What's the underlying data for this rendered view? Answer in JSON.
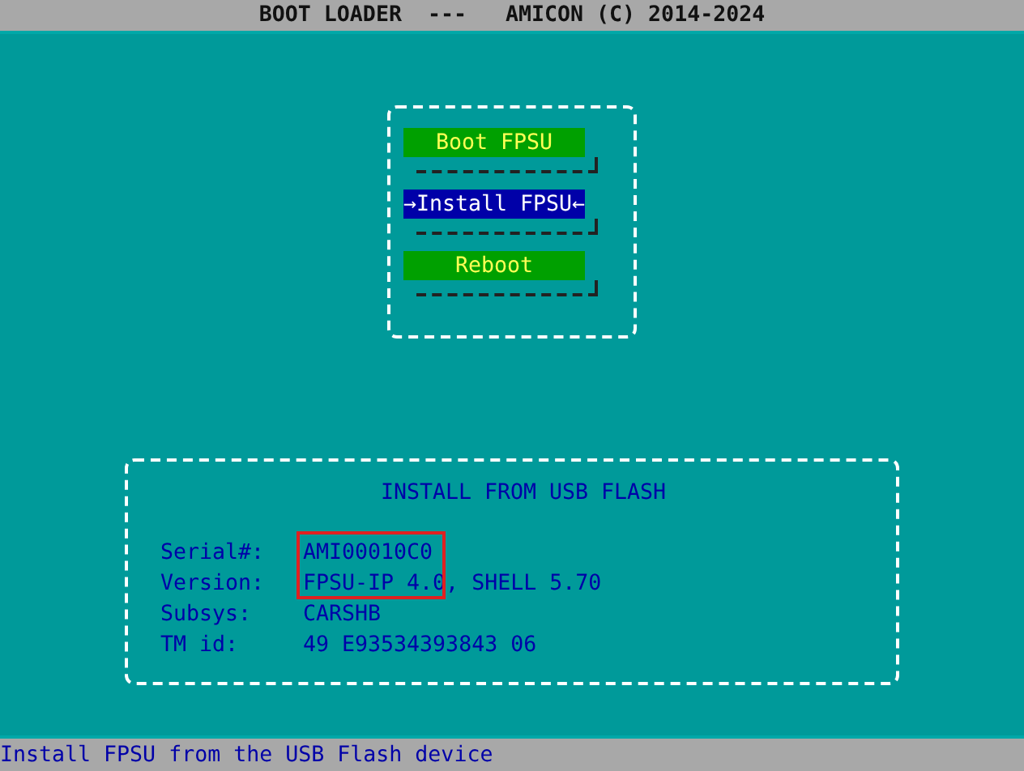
{
  "title_bar": {
    "title": "BOOT LOADER  ---   AMICON (C) 2014-2024"
  },
  "menu": {
    "items": [
      {
        "label": "Boot FPSU",
        "selected": false
      },
      {
        "label": "Install FPSU",
        "selected": true,
        "prefix": "→",
        "suffix": "←"
      },
      {
        "label": "Reboot",
        "selected": false
      }
    ]
  },
  "info_panel": {
    "title": "INSTALL FROM USB FLASH",
    "highlight_box": true,
    "rows": [
      {
        "label": "Serial#:",
        "value": "AMI00010C0"
      },
      {
        "label": "Version:",
        "value": "FPSU-IP 4.0, SHELL 5.70"
      },
      {
        "label": "Subsys:",
        "value": "CARSHB"
      },
      {
        "label": "TM id:",
        "value": "49 E93534393843 06"
      }
    ]
  },
  "status_bar": {
    "text": "Install FPSU from the USB Flash device"
  }
}
